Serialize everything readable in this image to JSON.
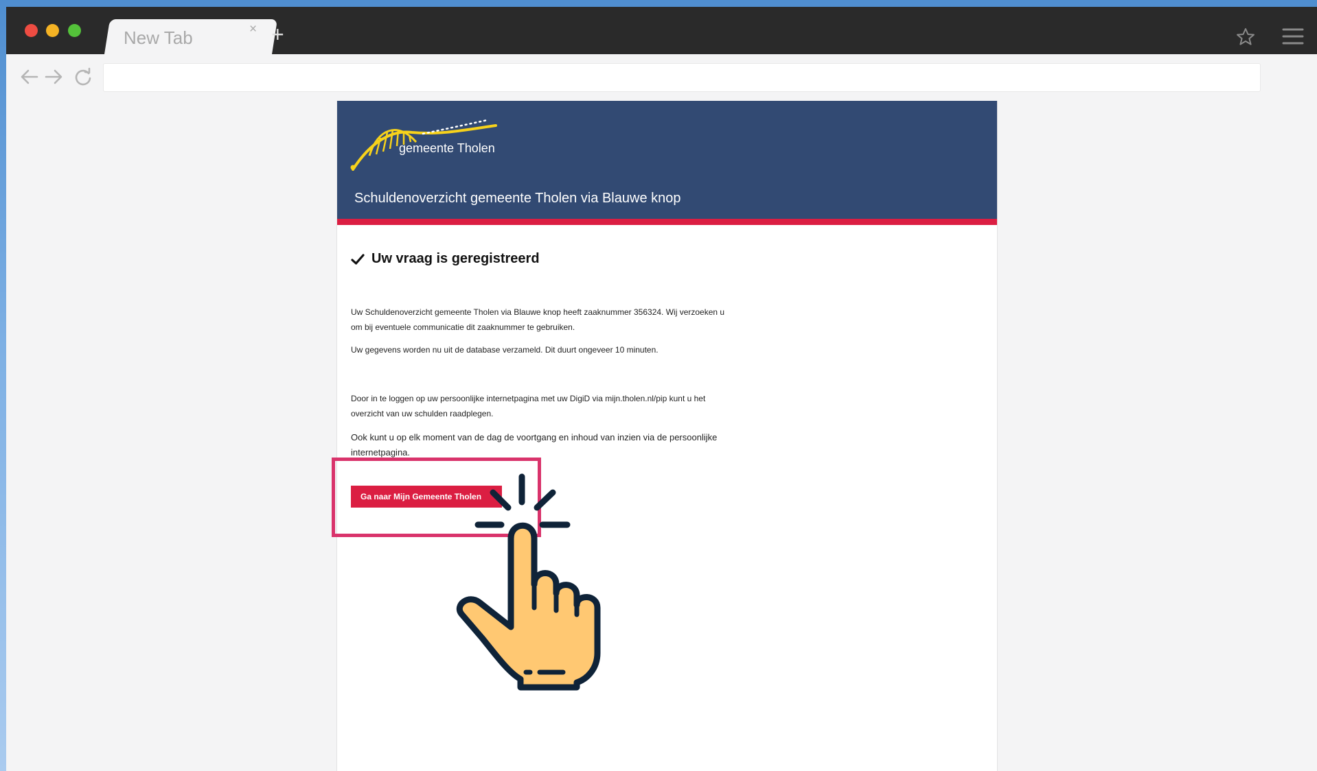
{
  "browser": {
    "tab_title": "New Tab",
    "tab_close": "×",
    "new_tab": "+",
    "address_value": ""
  },
  "icons": {
    "back": "back-arrow-icon",
    "forward": "forward-arrow-icon",
    "reload": "reload-icon",
    "bookmark": "star-icon",
    "menu": "hamburger-menu-icon",
    "check": "checkmark-icon",
    "pointer": "pointing-hand-icon"
  },
  "colors": {
    "header_bg": "#324a73",
    "accent_red": "#db1e42",
    "highlight": "#d9336b",
    "logo_yellow": "#f7d21b"
  },
  "header": {
    "logo_text": "gemeente Tholen",
    "service_title": "Schuldenoverzicht gemeente Tholen via Blauwe knop"
  },
  "main": {
    "confirm_title": "Uw vraag is geregistreerd",
    "paragraph_1": "Uw Schuldenoverzicht gemeente Tholen via Blauwe knop heeft zaaknummer 356324. Wij verzoeken u om bij eventuele communicatie dit zaaknummer te gebruiken.",
    "paragraph_2": "Uw gegevens worden nu uit de database verzameld. Dit duurt ongeveer 10 minuten.",
    "paragraph_3": "Door in te loggen op uw persoonlijke internetpagina met uw DigiD via mijn.tholen.nl/pip kunt u het overzicht van uw schulden raadplegen.",
    "paragraph_4": "Ook kunt u op elk moment van de dag de voortgang en inhoud van inzien via de persoonlijke internetpagina.",
    "cta_label": "Ga naar Mijn Gemeente Tholen"
  }
}
